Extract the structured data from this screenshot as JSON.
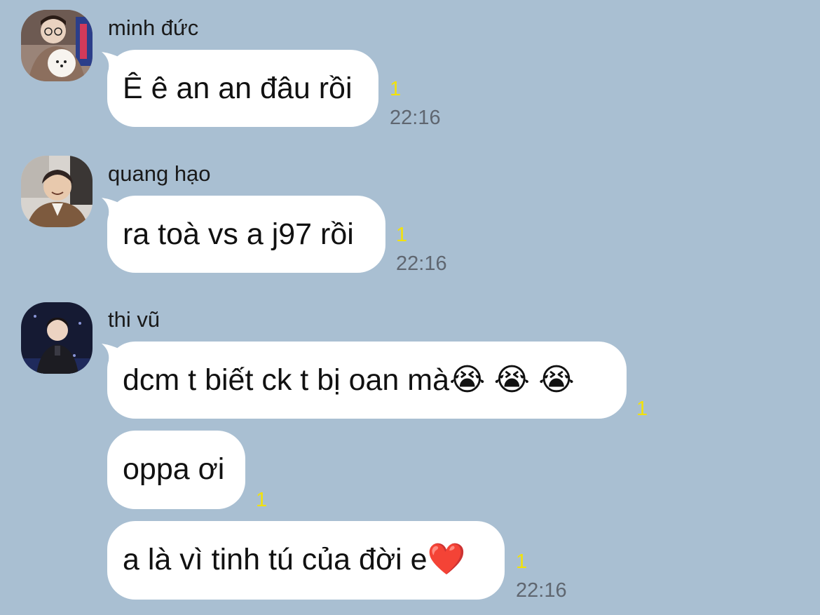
{
  "messages": [
    {
      "sender": "minh đức",
      "avatar_icon": "user-avatar-with-dog-icon",
      "bubbles": [
        {
          "text": "Ê ê an an đâu rồi",
          "unread": "1",
          "time": "22:16"
        }
      ]
    },
    {
      "sender": "quang hạo",
      "avatar_icon": "user-avatar-smiling-icon",
      "bubbles": [
        {
          "text": "ra toà vs a j97 rồi",
          "unread": "1",
          "time": "22:16"
        }
      ]
    },
    {
      "sender": "thi vũ",
      "avatar_icon": "user-avatar-stage-icon",
      "bubbles": [
        {
          "text": "dcm t biết ck t bị oan mà",
          "emoji": "😭 😭 😭",
          "unread": "1"
        },
        {
          "text": "oppa ơi",
          "unread": "1"
        },
        {
          "text": "a là vì tinh tú của đời e",
          "emoji": "❤️",
          "unread": "1",
          "time": "22:16"
        }
      ]
    }
  ],
  "colors": {
    "background": "#a9bfd2",
    "bubble": "#ffffff",
    "unread": "#f2e20a",
    "time": "#5f6670"
  }
}
